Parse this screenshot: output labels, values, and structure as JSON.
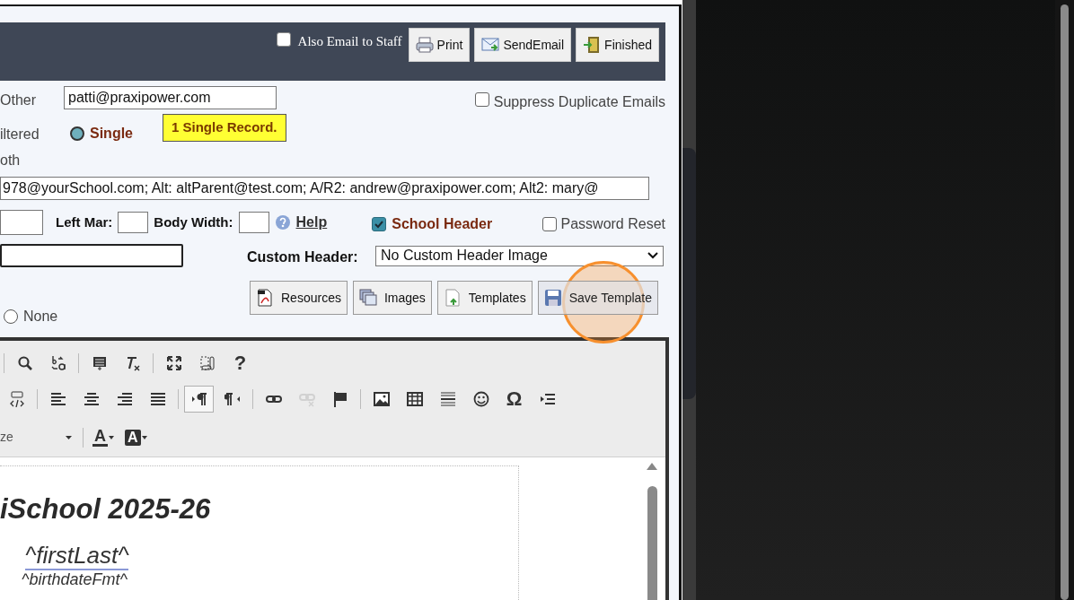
{
  "header": {
    "also_email_staff": {
      "label": "Also Email to Staff",
      "checked": false
    },
    "buttons": [
      {
        "label": "Print",
        "kind": "print"
      },
      {
        "label": "SendEmail",
        "kind": "email"
      },
      {
        "label": "Finished",
        "kind": "exit"
      }
    ]
  },
  "recipients": {
    "other_label": "Other",
    "other_email": "patti@praxipower.com",
    "suppress": {
      "label": "Suppress Duplicate Emails",
      "checked": false
    }
  },
  "record_options": {
    "filtered_label": "iltered",
    "single": {
      "label": "Single",
      "selected": true
    },
    "badge": "1 Single Record.",
    "both_label": "oth",
    "none": {
      "label": "None",
      "selected": false
    }
  },
  "to_field": "978@yourSchool.com; Alt: altParent@test.com; A/R2: andrew@praxipower.com; Alt2: mary@",
  "layout": {
    "left_mar_label": "Left Mar:",
    "body_width_label": "Body Width:",
    "help": "Help",
    "school_header": {
      "label": "School Header",
      "checked": true
    },
    "password_reset": {
      "label": "Password Reset",
      "checked": false
    }
  },
  "custom_header": {
    "label": "Custom Header:",
    "value": "No Custom Header Image"
  },
  "tool_buttons": [
    {
      "label": "Resources",
      "kind": "pdf",
      "active": false
    },
    {
      "label": "Images",
      "kind": "images",
      "active": false
    },
    {
      "label": "Templates",
      "kind": "template",
      "active": false
    },
    {
      "label": "Save Template",
      "kind": "save",
      "active": true
    }
  ],
  "editor": {
    "toolbar_rows": [
      [
        {
          "kind": "sep"
        },
        {
          "kind": "search"
        },
        {
          "kind": "replace"
        },
        {
          "kind": "sep"
        },
        {
          "kind": "source"
        },
        {
          "kind": "removeformat"
        },
        {
          "kind": "sep"
        },
        {
          "kind": "maximize"
        },
        {
          "kind": "showblocks"
        },
        {
          "kind": "glyph",
          "text": "?"
        }
      ],
      [
        {
          "kind": "div",
          "pressed": false,
          "disabled": false
        },
        {
          "kind": "sep"
        },
        {
          "kind": "align-left",
          "pressed": false,
          "disabled": false
        },
        {
          "kind": "align-center",
          "pressed": false,
          "disabled": false
        },
        {
          "kind": "align-right",
          "pressed": false,
          "disabled": false
        },
        {
          "kind": "justify",
          "pressed": false,
          "disabled": false
        },
        {
          "kind": "sep"
        },
        {
          "kind": "ltr",
          "pressed": true,
          "disabled": false
        },
        {
          "kind": "rtl",
          "pressed": false,
          "disabled": false
        },
        {
          "kind": "sep"
        },
        {
          "kind": "link",
          "pressed": false,
          "disabled": false
        },
        {
          "kind": "unlink",
          "pressed": false,
          "disabled": true
        },
        {
          "kind": "flag",
          "pressed": false,
          "disabled": false
        },
        {
          "kind": "sep"
        },
        {
          "kind": "image",
          "pressed": false,
          "disabled": false
        },
        {
          "kind": "table",
          "pressed": false,
          "disabled": false
        },
        {
          "kind": "hr",
          "pressed": false,
          "disabled": false
        },
        {
          "kind": "smiley",
          "pressed": false,
          "disabled": false
        },
        {
          "kind": "glyph",
          "text": "Ω",
          "pressed": false,
          "disabled": false
        },
        {
          "kind": "indent",
          "pressed": false,
          "disabled": false
        }
      ],
      [
        {
          "kind": "combo",
          "text": "ze"
        },
        {
          "kind": "sep"
        },
        {
          "kind": "textcolor",
          "text": "A"
        },
        {
          "kind": "bgcolor",
          "text": "A"
        }
      ]
    ],
    "document": {
      "title": "iSchool 2025-26",
      "lines": [
        "^firstLast^",
        "^birthdateFmt^"
      ]
    }
  }
}
